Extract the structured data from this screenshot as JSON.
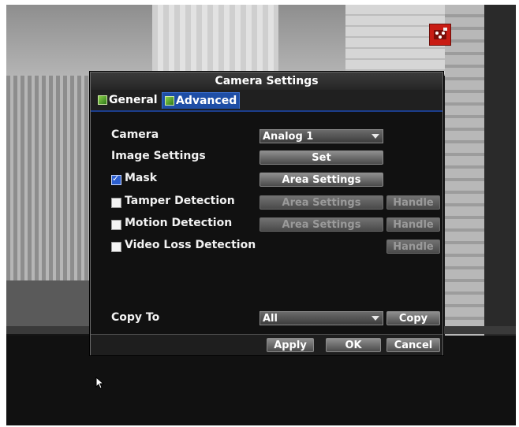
{
  "dialog": {
    "title": "Camera Settings",
    "tabs": [
      {
        "label": "General"
      },
      {
        "label": "Advanced",
        "active": true
      }
    ]
  },
  "form": {
    "camera_label": "Camera",
    "camera_value": "Analog 1",
    "image_settings_label": "Image Settings",
    "image_settings_button": "Set",
    "mask": {
      "label": "Mask",
      "checked": true,
      "button": "Area Settings"
    },
    "tamper": {
      "label": "Tamper Detection",
      "checked": false,
      "area_button": "Area Settings",
      "handle_button": "Handle"
    },
    "motion": {
      "label": "Motion Detection",
      "checked": false,
      "area_button": "Area Settings",
      "handle_button": "Handle"
    },
    "video_loss": {
      "label": "Video Loss Detection",
      "checked": false,
      "handle_button": "Handle"
    },
    "copy_to_label": "Copy To",
    "copy_to_value": "All",
    "copy_button": "Copy"
  },
  "footer": {
    "apply": "Apply",
    "ok": "OK",
    "cancel": "Cancel"
  },
  "icons": {
    "record_status": "record-status-icon",
    "tab": "tab-icon",
    "cursor": "mouse-pointer-icon"
  },
  "colors": {
    "accent": "#1e4ea6",
    "dialog_bg": "#111111",
    "record": "#c81c14"
  }
}
